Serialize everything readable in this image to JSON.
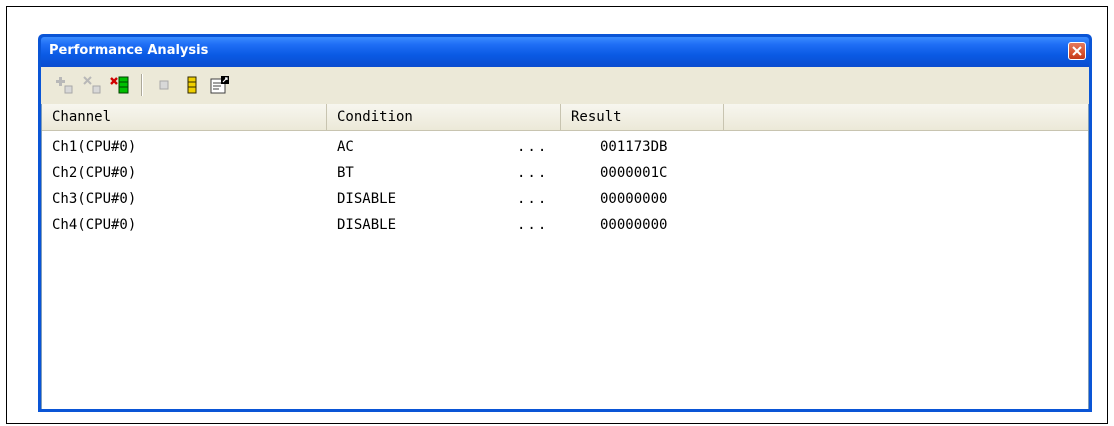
{
  "window": {
    "title": "Performance Analysis"
  },
  "toolbar": {
    "buttons": [
      {
        "name": "add-channel",
        "icon": "add-gray-icon",
        "enabled": false
      },
      {
        "name": "remove-channel",
        "icon": "remove-gray-icon",
        "enabled": false
      },
      {
        "name": "remove-all",
        "icon": "remove-all-red-x-icon",
        "enabled": true
      },
      {
        "name": "reset",
        "icon": "reset-gray-icon",
        "enabled": false
      },
      {
        "name": "reset-all",
        "icon": "reset-all-yellow-icon",
        "enabled": true
      },
      {
        "name": "properties",
        "icon": "properties-icon",
        "enabled": true
      }
    ]
  },
  "table": {
    "columns": [
      "Channel",
      "Condition",
      "Result",
      ""
    ],
    "ellipsis": "...",
    "rows": [
      {
        "channel": "Ch1(CPU#0)",
        "condition": "AC",
        "result": "001173DB"
      },
      {
        "channel": "Ch2(CPU#0)",
        "condition": "BT",
        "result": "0000001C"
      },
      {
        "channel": "Ch3(CPU#0)",
        "condition": "DISABLE",
        "result": "00000000"
      },
      {
        "channel": "Ch4(CPU#0)",
        "condition": "DISABLE",
        "result": "00000000"
      }
    ]
  },
  "colors": {
    "titlebar": "#0a5ae4",
    "toolbar_bg": "#ece9d8",
    "close_button": "#d8542f",
    "icon_green": "#00c000",
    "icon_red": "#d00000",
    "icon_yellow": "#f0d000"
  }
}
